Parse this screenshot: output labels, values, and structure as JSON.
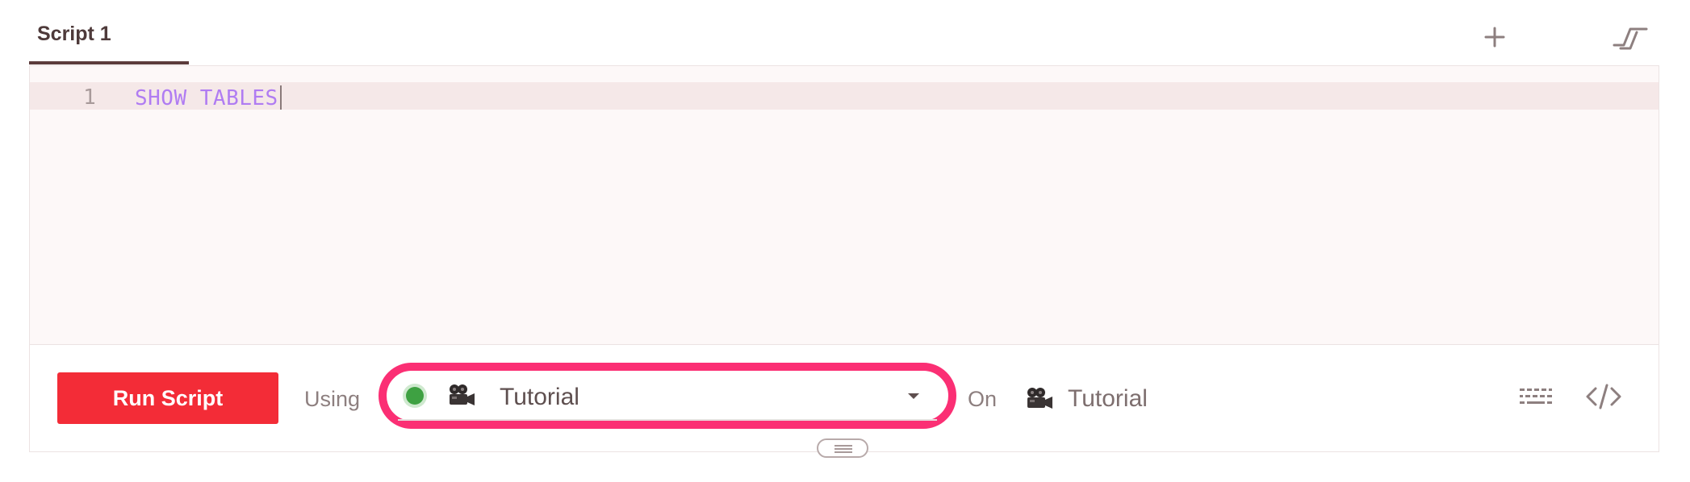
{
  "tabs": [
    {
      "label": "Script 1",
      "active": true
    }
  ],
  "tab_actions": {
    "add_icon": "plus-icon",
    "collapse_icon": "collapse-panel-icon"
  },
  "editor": {
    "lines": [
      {
        "number": "1",
        "text": "SHOW TABLES"
      }
    ],
    "keyword_color": "#b07cf2",
    "active_line_color": "#f5e8e8"
  },
  "toolbar": {
    "run_label": "Run Script",
    "run_color": "#f32c37",
    "using_label": "Using",
    "database_select": {
      "status_icon": "status-dot-icon",
      "status_color": "#3ea142",
      "db_icon": "movie-camera-icon",
      "value": "Tutorial",
      "highlight_color": "#fb2f74"
    },
    "on_label": "On",
    "on_icon": "movie-camera-icon",
    "on_value": "Tutorial",
    "keyboard_icon": "keyboard-icon",
    "code_icon": "code-icon"
  },
  "resize_handle_icon": "drag-handle-icon"
}
